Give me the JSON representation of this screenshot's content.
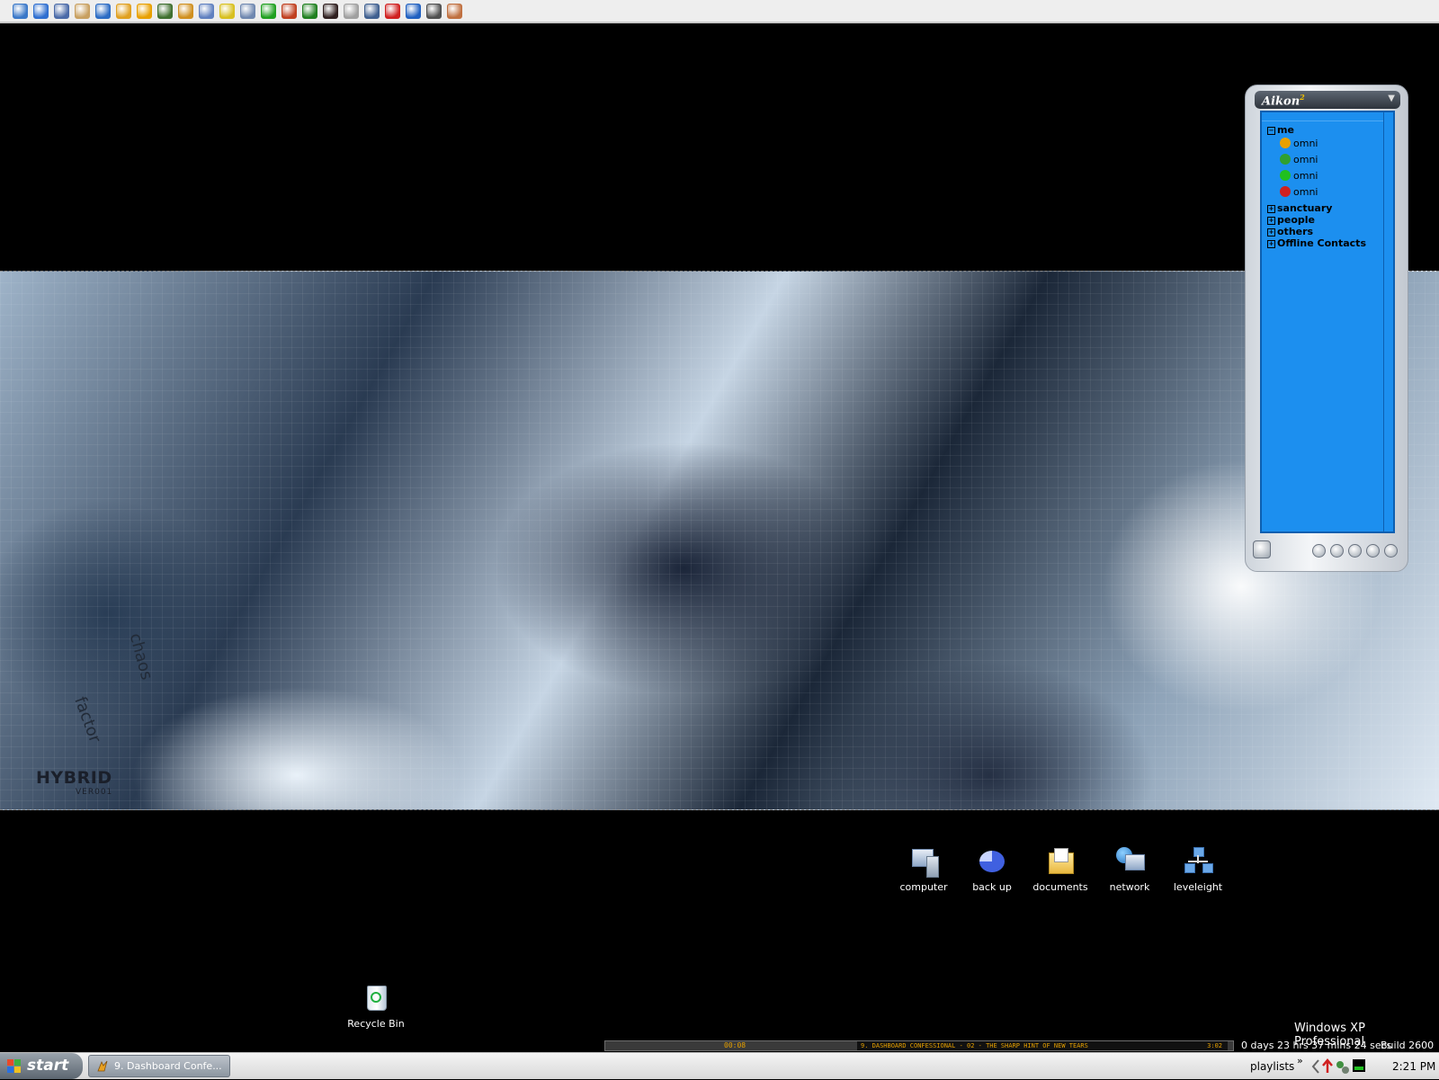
{
  "toolbar": {
    "icons": [
      {
        "name": "quicklaunch-icon-1",
        "color": "#3a78c8"
      },
      {
        "name": "internet-explorer-icon",
        "color": "#2f6fd0"
      },
      {
        "name": "quicklaunch-icon-3",
        "color": "#4a6aa8"
      },
      {
        "name": "quicklaunch-icon-4",
        "color": "#c8a060"
      },
      {
        "name": "outlook-icon",
        "color": "#2c6cc4"
      },
      {
        "name": "media-player-icon",
        "color": "#e0a020"
      },
      {
        "name": "aim-icon",
        "color": "#e8a000"
      },
      {
        "name": "network-tool-icon",
        "color": "#407030"
      },
      {
        "name": "quicklaunch-icon-9",
        "color": "#d09020"
      },
      {
        "name": "quicklaunch-icon-10",
        "color": "#6080c0"
      },
      {
        "name": "quicklaunch-icon-11",
        "color": "#d8c020"
      },
      {
        "name": "quicklaunch-icon-12",
        "color": "#7088b0"
      },
      {
        "name": "quicklaunch-icon-13",
        "color": "#20a020"
      },
      {
        "name": "quicklaunch-icon-14",
        "color": "#c04020"
      },
      {
        "name": "quicklaunch-icon-15",
        "color": "#208020"
      },
      {
        "name": "quicklaunch-icon-16",
        "color": "#302020"
      },
      {
        "name": "quicklaunch-icon-17",
        "color": "#a0a0a0"
      },
      {
        "name": "quicklaunch-icon-18",
        "color": "#406090"
      },
      {
        "name": "quicklaunch-icon-19",
        "color": "#d02020"
      },
      {
        "name": "quicklaunch-icon-20",
        "color": "#2060c0"
      },
      {
        "name": "quicklaunch-icon-21",
        "color": "#505050"
      },
      {
        "name": "quicklaunch-icon-22",
        "color": "#c07040"
      }
    ]
  },
  "wallpaper": {
    "brand": "HYBRID",
    "version": "VER001",
    "word1": "chaos",
    "word2": "factor"
  },
  "aikon": {
    "title": "Aikon",
    "title_sup": "2",
    "groups": [
      {
        "label": "me",
        "expanded": true,
        "contacts": [
          {
            "label": "omni",
            "icon": "aim-icon",
            "color": "#e8a000"
          },
          {
            "label": "omni",
            "icon": "msn-icon",
            "color": "#30a030"
          },
          {
            "label": "omni",
            "icon": "icq-icon",
            "color": "#20c020"
          },
          {
            "label": "omni",
            "icon": "yahoo-icon",
            "color": "#d02020"
          }
        ]
      },
      {
        "label": "sanctuary",
        "expanded": false
      },
      {
        "label": "people",
        "expanded": false
      },
      {
        "label": "others",
        "expanded": false
      },
      {
        "label": "Offline Contacts",
        "expanded": false
      }
    ]
  },
  "desktop_icons": [
    {
      "label": "computer",
      "icon": "computer-icon"
    },
    {
      "label": "back up",
      "icon": "backup-icon"
    },
    {
      "label": "documents",
      "icon": "documents-folder-icon"
    },
    {
      "label": "network",
      "icon": "network-icon"
    },
    {
      "label": "leveleight",
      "icon": "leveleight-icon"
    },
    {
      "label": "Recycle Bin",
      "icon": "recycle-bin-icon"
    }
  ],
  "winamp": {
    "elapsed": "00:08",
    "track": "9. DASHBOARD CONFESSIONAL - 02 - THE SHARP HINT OF NEW TEARS",
    "track_time": "3:02"
  },
  "watermark": {
    "os": "Windows XP Professional",
    "uptime": "0 days 23 hrs 37 mins 24 secs",
    "build": "Build 2600"
  },
  "taskbar": {
    "start_label": "start",
    "task_label": "9. Dashboard Confe...",
    "playlists_label": "playlists",
    "chevron": "»",
    "clock": "2:21 PM"
  }
}
